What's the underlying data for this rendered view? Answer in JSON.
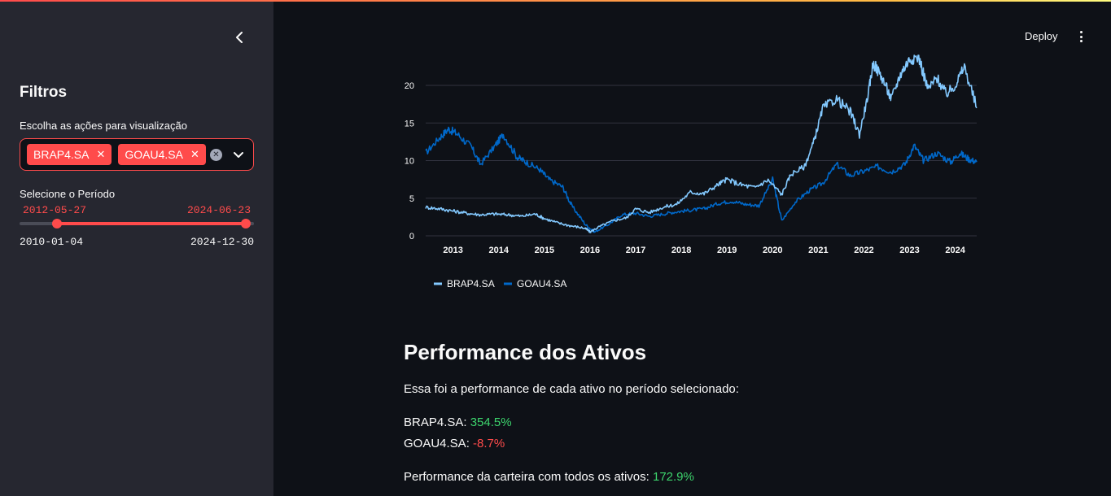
{
  "sidebar": {
    "title": "Filtros",
    "stocks_label": "Escolha as ações para visualização",
    "selected_stocks": [
      "BRAP4.SA",
      "GOAU4.SA"
    ],
    "period_label": "Selecione o Período",
    "period_start": "2012-05-27",
    "period_end": "2024-06-23",
    "range_min": "2010-01-04",
    "range_max": "2024-12-30",
    "range_fraction": {
      "start": 0.1577,
      "end": 0.9655
    }
  },
  "header": {
    "deploy_label": "Deploy"
  },
  "chart_data": {
    "type": "line",
    "title": "",
    "xlabel": "",
    "ylabel": "",
    "x_ticks": [
      "2013",
      "2014",
      "2015",
      "2016",
      "2017",
      "2018",
      "2019",
      "2020",
      "2021",
      "2022",
      "2023",
      "2024"
    ],
    "y_ticks": [
      "0",
      "5",
      "10",
      "15",
      "20"
    ],
    "ylim": [
      0,
      24
    ],
    "xlim": [
      2012.4,
      2024.47
    ],
    "grid": true,
    "legend": "bottom-left",
    "series": [
      {
        "name": "BRAP4.SA",
        "color": "#83c9ff",
        "x": [
          2012.4,
          2012.7,
          2013.0,
          2013.3,
          2013.6,
          2013.9,
          2014.2,
          2014.5,
          2014.8,
          2015.0,
          2015.3,
          2015.6,
          2015.9,
          2016.0,
          2016.2,
          2016.5,
          2016.8,
          2017.0,
          2017.3,
          2017.6,
          2017.9,
          2018.2,
          2018.5,
          2018.8,
          2019.0,
          2019.3,
          2019.6,
          2019.9,
          2020.2,
          2020.4,
          2020.7,
          2020.9,
          2021.1,
          2021.4,
          2021.7,
          2021.9,
          2022.1,
          2022.2,
          2022.4,
          2022.6,
          2022.8,
          2023.0,
          2023.2,
          2023.4,
          2023.6,
          2023.8,
          2024.0,
          2024.2,
          2024.47
        ],
        "y": [
          3.8,
          3.6,
          3.3,
          3.0,
          2.8,
          2.9,
          2.8,
          2.6,
          2.9,
          2.3,
          1.7,
          1.3,
          1.0,
          0.5,
          1.2,
          2.0,
          2.4,
          3.6,
          3.1,
          3.8,
          4.2,
          5.8,
          5.6,
          6.8,
          7.5,
          6.8,
          6.4,
          7.4,
          5.5,
          8.2,
          9.2,
          12.5,
          17.0,
          18.2,
          16.5,
          13.5,
          19.0,
          23.0,
          21.0,
          18.2,
          21.5,
          23.5,
          23.8,
          19.5,
          21.0,
          18.8,
          20.0,
          22.5,
          17.0
        ]
      },
      {
        "name": "GOAU4.SA",
        "color": "#0068c9",
        "x": [
          2012.4,
          2012.7,
          2012.9,
          2013.1,
          2013.4,
          2013.6,
          2013.9,
          2014.1,
          2014.4,
          2014.6,
          2014.9,
          2015.1,
          2015.4,
          2015.6,
          2015.9,
          2016.1,
          2016.4,
          2016.7,
          2017.0,
          2017.3,
          2017.6,
          2017.9,
          2018.2,
          2018.5,
          2018.8,
          2019.1,
          2019.4,
          2019.7,
          2020.0,
          2020.2,
          2020.5,
          2020.8,
          2021.1,
          2021.4,
          2021.7,
          2022.0,
          2022.3,
          2022.6,
          2022.9,
          2023.1,
          2023.3,
          2023.6,
          2023.9,
          2024.1,
          2024.3,
          2024.47
        ],
        "y": [
          11.0,
          13.0,
          14.2,
          13.5,
          11.8,
          9.5,
          11.8,
          13.5,
          10.5,
          9.8,
          8.8,
          7.5,
          6.5,
          4.0,
          1.5,
          0.5,
          1.5,
          2.8,
          3.0,
          2.6,
          2.9,
          3.2,
          3.4,
          3.6,
          4.3,
          4.6,
          4.2,
          4.0,
          7.5,
          2.0,
          4.5,
          6.0,
          7.0,
          9.5,
          8.0,
          8.6,
          9.2,
          8.5,
          9.5,
          12.0,
          10.0,
          11.0,
          9.8,
          11.0,
          10.2,
          9.8
        ]
      }
    ]
  },
  "performance": {
    "title": "Performance dos Ativos",
    "intro": "Essa foi a performance de cada ativo no período selecionado:",
    "items": [
      {
        "label": "BRAP4.SA: ",
        "value": "354.5%",
        "status": "pos"
      },
      {
        "label": "GOAU4.SA: ",
        "value": "-8.7%",
        "status": "neg"
      }
    ],
    "portfolio_label": "Performance da carteira com todos os ativos: ",
    "portfolio_value": "172.9%"
  },
  "colors": {
    "accent": "#ff4b4b",
    "sidebar_bg": "#262730",
    "main_bg": "#0e1117",
    "positive": "#3dd56d",
    "negative": "#ff4b4b"
  }
}
